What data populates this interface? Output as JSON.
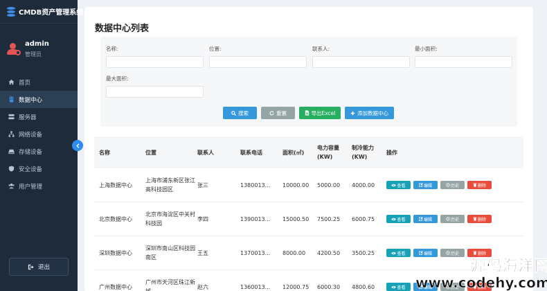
{
  "sidebar": {
    "app_title": "CMDB资产管理系统",
    "user_name": "admin",
    "user_role": "管理员",
    "items": [
      {
        "label": "首页",
        "icon": "home-icon"
      },
      {
        "label": "数据中心",
        "icon": "building-icon",
        "active": true
      },
      {
        "label": "服务器",
        "icon": "server-icon"
      },
      {
        "label": "网络设备",
        "icon": "network-icon"
      },
      {
        "label": "存储设备",
        "icon": "storage-icon"
      },
      {
        "label": "安全设备",
        "icon": "shield-icon"
      },
      {
        "label": "用户管理",
        "icon": "users-icon"
      }
    ],
    "logout_label": "退出"
  },
  "page": {
    "title": "数据中心列表"
  },
  "filters": {
    "name_label": "名称:",
    "location_label": "位置:",
    "contact_label": "联系人:",
    "min_area_label": "最小面积:",
    "max_area_label": "最大面积:",
    "search_label": "搜索",
    "reset_label": "重置",
    "export_label": "导出Excel",
    "add_label": "添加数据中心"
  },
  "table": {
    "headers": [
      "名称",
      "位置",
      "联系人",
      "联系电话",
      "面积(㎡)",
      "电力容量(KW)",
      "制冷能力(KW)",
      "操作"
    ],
    "actions": {
      "view": "查看",
      "edit": "编辑",
      "history": "历史",
      "delete": "删除"
    },
    "rows": [
      {
        "name": "上海数据中心",
        "location": "上海市浦东新区张江高科技园区",
        "contact": "张三",
        "phone": "1380013...",
        "area": "10000.00",
        "power": "5000.00",
        "cooling": "4000.00"
      },
      {
        "name": "北京数据中心",
        "location": "北京市海淀区中关村科技园",
        "contact": "李四",
        "phone": "1390013...",
        "area": "15000.50",
        "power": "7500.25",
        "cooling": "6000.75"
      },
      {
        "name": "深圳数据中心",
        "location": "深圳市南山区科技园南区",
        "contact": "王五",
        "phone": "1370013...",
        "area": "8000.00",
        "power": "4200.50",
        "cooling": "3500.25"
      },
      {
        "name": "广州数据中心",
        "location": "广州市天河区珠江新城",
        "contact": "赵六",
        "phone": "1360013...",
        "area": "12000.75",
        "power": "6000.30",
        "cooling": "4800.60"
      }
    ]
  },
  "watermark": {
    "cn": "源码海洋网",
    "en": "www.codehy.com"
  },
  "colors": {
    "sidebar_bg": "#1d2b3a",
    "primary": "#3498db",
    "success": "#27ae60",
    "info": "#17a2b8",
    "danger": "#e74c3c",
    "muted": "#95a5a6"
  }
}
